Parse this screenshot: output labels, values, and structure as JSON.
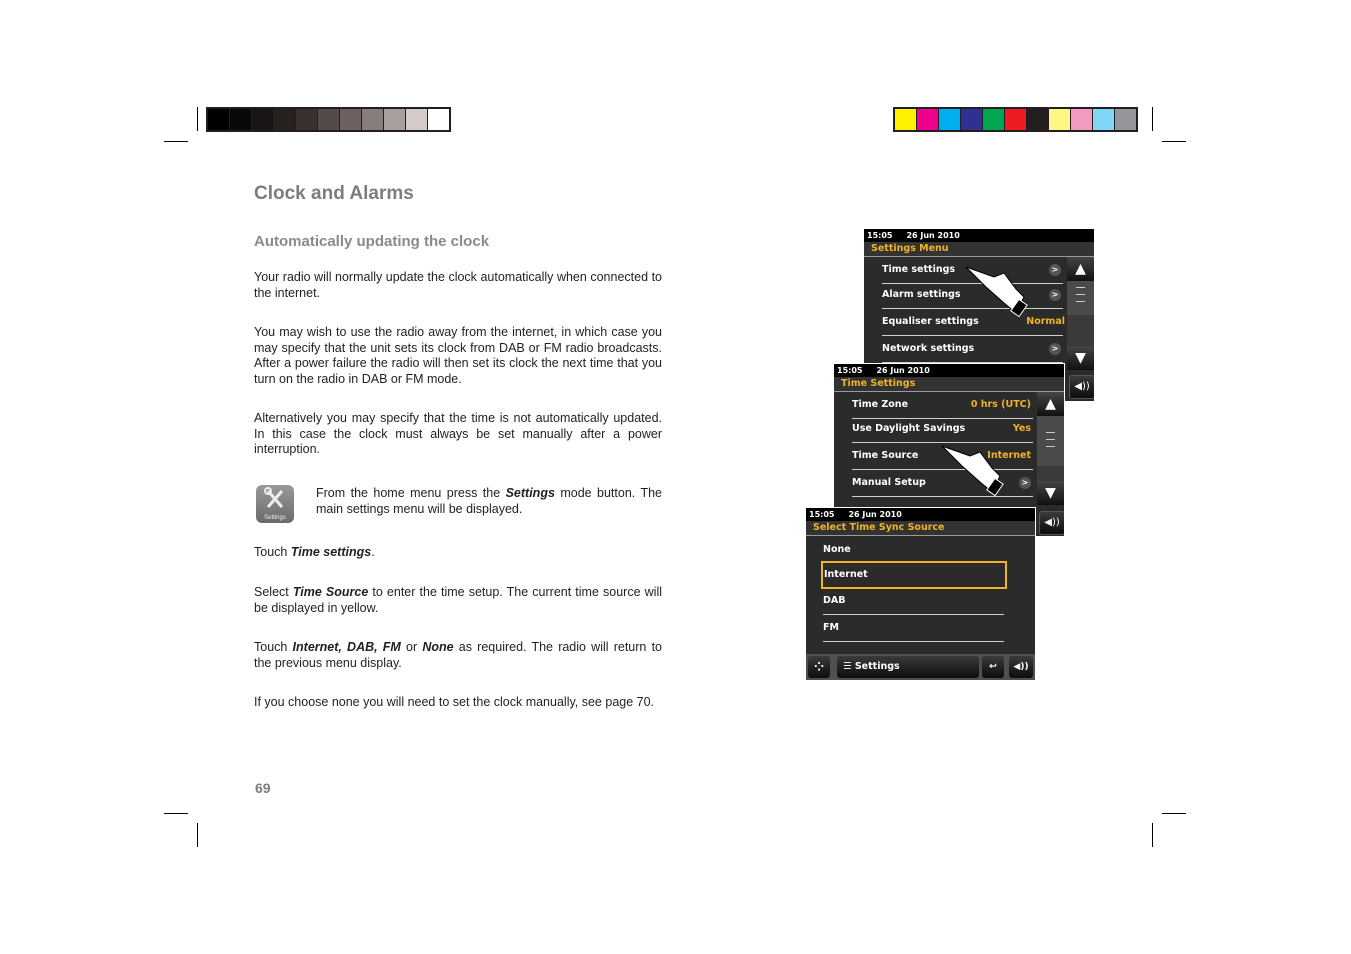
{
  "page": {
    "title": "Clock and Alarms",
    "subtitle": "Automatically updating the clock",
    "page_number": "69"
  },
  "color_bars": {
    "grayscale": [
      "#000000",
      "#0b0908",
      "#1a1615",
      "#26211f",
      "#3a302d",
      "#544a47",
      "#6d625f",
      "#877d7a",
      "#a8a09e",
      "#d3cbca",
      "#ffffff"
    ],
    "process": [
      "#fff200",
      "#ec008c",
      "#00aeef",
      "#2e3192",
      "#00a651",
      "#ed1c24",
      "#231f20",
      "#fff685",
      "#f49ac1",
      "#7fd6f7",
      "#939598"
    ]
  },
  "paragraphs": {
    "p1": "Your radio will normally update the clock automatically when connected to the internet.",
    "p2": "You may wish to use the radio away from the internet, in which case you may specify that the unit sets its clock from DAB or FM radio broadcasts. After a power failure the radio will then set its clock the next time that you turn on the radio in DAB or FM mode.",
    "p3": "Alternatively you may specify that the time is not automatically updated. In this case the clock must always be set manually after a power interruption.",
    "p4_pre": "From the home menu press the ",
    "p4_bold": "Settings",
    "p4_post": " mode button. The main settings menu will be displayed.",
    "p5_pre": "Touch ",
    "p5_bold": "Time settings",
    "p5_post": ".",
    "p6_pre": "Select ",
    "p6_bold": "Time Source",
    "p6_post": " to enter the time setup. The current time source will be displayed in yellow.",
    "p7_pre": "Touch ",
    "p7_bold1": "Internet, DAB, FM",
    "p7_mid": " or ",
    "p7_bold2": "None",
    "p7_post": " as required. The radio will return to the previous menu display.",
    "p8": "If you choose none you will need to set the clock manually, see page 70."
  },
  "settings_icon_label": "Settings",
  "screens": {
    "settings_menu": {
      "time": "15:05",
      "date": "26 Jun 2010",
      "title": "Settings Menu",
      "items": [
        {
          "label": "Time settings",
          "value": "",
          "chevron": ">"
        },
        {
          "label": "Alarm settings",
          "value": "",
          "chevron": ">"
        },
        {
          "label": "Equaliser settings",
          "value": "Normal",
          "chevron": ""
        },
        {
          "label": "Network settings",
          "value": "",
          "chevron": ">"
        }
      ]
    },
    "time_settings": {
      "time": "15:05",
      "date": "26 Jun 2010",
      "title": "Time Settings",
      "items": [
        {
          "label": "Time Zone",
          "value": "0 hrs (UTC)",
          "chevron": ""
        },
        {
          "label": "Use Daylight Savings",
          "value": "Yes",
          "chevron": ""
        },
        {
          "label": "Time Source",
          "value": "Internet",
          "chevron": ""
        },
        {
          "label": "Manual Setup",
          "value": "",
          "chevron": ">"
        }
      ]
    },
    "time_sync": {
      "time": "15:05",
      "date": "26 Jun 2010",
      "title": "Select Time Sync Source",
      "items": [
        "None",
        "Internet",
        "DAB",
        "FM"
      ],
      "selected": "Internet",
      "bottom_label": "Settings"
    }
  },
  "icons": {
    "up": "▲",
    "down": "▼",
    "volume": "◀))",
    "back": "↩",
    "menu": "☰",
    "home": "⁘"
  },
  "accent_color": "#f0b323"
}
